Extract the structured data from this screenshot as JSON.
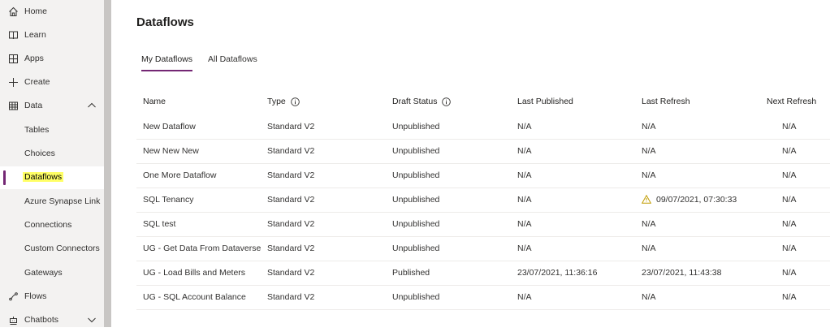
{
  "sidebar": {
    "items": [
      {
        "label": "Home",
        "icon": "home-icon"
      },
      {
        "label": "Learn",
        "icon": "book-icon"
      },
      {
        "label": "Apps",
        "icon": "apps-icon"
      },
      {
        "label": "Create",
        "icon": "plus-icon"
      },
      {
        "label": "Data",
        "icon": "table-icon",
        "expanded": true
      },
      {
        "label": "Tables"
      },
      {
        "label": "Choices"
      },
      {
        "label": "Dataflows",
        "selected": true
      },
      {
        "label": "Azure Synapse Link"
      },
      {
        "label": "Connections"
      },
      {
        "label": "Custom Connectors"
      },
      {
        "label": "Gateways"
      },
      {
        "label": "Flows",
        "icon": "flows-icon"
      },
      {
        "label": "Chatbots",
        "icon": "chatbot-icon",
        "expanded": false
      }
    ]
  },
  "page": {
    "title": "Dataflows",
    "tabs": [
      {
        "label": "My Dataflows",
        "active": true
      },
      {
        "label": "All Dataflows",
        "active": false
      }
    ]
  },
  "table": {
    "columns": [
      "Name",
      "Type",
      "Draft Status",
      "Last Published",
      "Last Refresh",
      "Next Refresh"
    ],
    "rows": [
      [
        "New Dataflow",
        "Standard V2",
        "Unpublished",
        "N/A",
        "N/A",
        "N/A"
      ],
      [
        "New New New",
        "Standard V2",
        "Unpublished",
        "N/A",
        "N/A",
        "N/A"
      ],
      [
        "One More Dataflow",
        "Standard V2",
        "Unpublished",
        "N/A",
        "N/A",
        "N/A"
      ],
      [
        "SQL Tenancy",
        "Standard V2",
        "Unpublished",
        "N/A",
        "09/07/2021, 07:30:33",
        "N/A"
      ],
      [
        "SQL test",
        "Standard V2",
        "Unpublished",
        "N/A",
        "N/A",
        "N/A"
      ],
      [
        "UG - Get Data From Dataverse",
        "Standard V2",
        "Unpublished",
        "N/A",
        "N/A",
        "N/A"
      ],
      [
        "UG - Load Bills and Meters",
        "Standard V2",
        "Published",
        "23/07/2021, 11:36:16",
        "23/07/2021, 11:43:38",
        "N/A"
      ],
      [
        "UG - SQL Account Balance",
        "Standard V2",
        "Unpublished",
        "N/A",
        "N/A",
        "N/A"
      ]
    ],
    "warning_row": 3
  },
  "colors": {
    "accent": "#742774",
    "highlight": "#ffff66",
    "warning": "#c19c00"
  }
}
